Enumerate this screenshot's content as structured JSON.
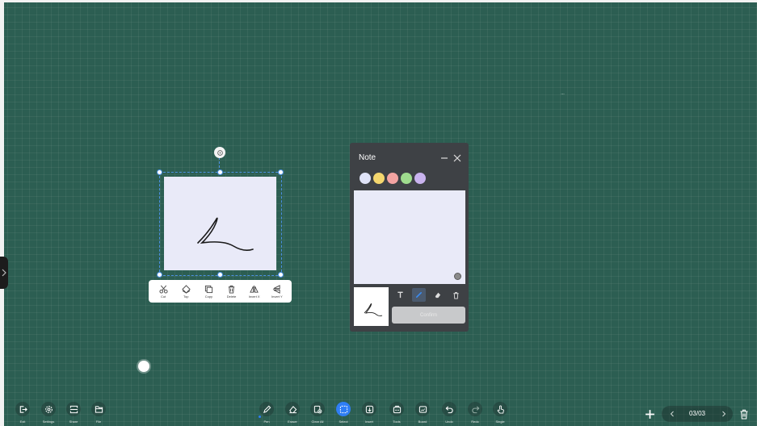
{
  "colors": {
    "board": "#2c5e52",
    "accent": "#2f7ef5",
    "note_panel": "#3e4145",
    "sticky": "#e9eaf8"
  },
  "object_toolbar": {
    "items": [
      {
        "icon": "scissors-icon",
        "label": "Cut"
      },
      {
        "icon": "top-layer-icon",
        "label": "Top"
      },
      {
        "icon": "copy-icon",
        "label": "Copy"
      },
      {
        "icon": "trash-icon",
        "label": "Delete"
      },
      {
        "icon": "invert-x-icon",
        "label": "Invert X"
      },
      {
        "icon": "invert-y-icon",
        "label": "Invert Y"
      }
    ]
  },
  "note": {
    "title": "Note",
    "colors": [
      "#dfe3f7",
      "#f4d76e",
      "#f3a3a1",
      "#9fdc8e",
      "#c9b3ee"
    ],
    "tools": [
      "text-icon",
      "pen-icon",
      "eraser-icon",
      "trash-icon"
    ],
    "confirm_label": "Confirm"
  },
  "bottom_left": [
    {
      "icon": "exit-icon",
      "label": "Exit"
    },
    {
      "icon": "settings-icon",
      "label": "Settings"
    },
    {
      "icon": "share-icon",
      "label": "Share"
    },
    {
      "icon": "file-icon",
      "label": "File"
    }
  ],
  "bottom_center": [
    {
      "icon": "pen-icon",
      "label": "Pen"
    },
    {
      "icon": "eraser-icon",
      "label": "Eraser"
    },
    {
      "icon": "clear-all-icon",
      "label": "Clear All"
    },
    {
      "icon": "select-icon",
      "label": "Select",
      "selected": true
    },
    {
      "icon": "insert-icon",
      "label": "Insert"
    },
    {
      "icon": "tools-icon",
      "label": "Tools"
    },
    {
      "icon": "board-icon",
      "label": "Board"
    },
    {
      "icon": "undo-icon",
      "label": "Undo"
    },
    {
      "icon": "redo-icon",
      "label": "Redo"
    },
    {
      "icon": "single-touch-icon",
      "label": "Single"
    }
  ],
  "pagination": {
    "page": "03/03"
  }
}
